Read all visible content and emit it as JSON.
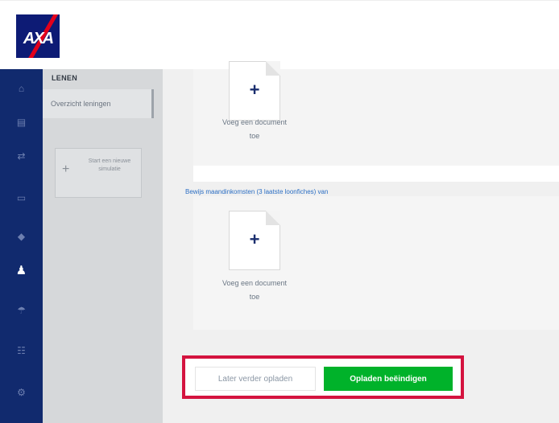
{
  "brand": {
    "logo_text": "AXA",
    "logo_bg": "#0d1b75",
    "logo_slash": "#e3001b"
  },
  "nav": {
    "icons": [
      {
        "name": "home-icon",
        "glyph": "⌂"
      },
      {
        "name": "accounts-icon",
        "glyph": "▤"
      },
      {
        "name": "transfer-icon",
        "glyph": "⇄"
      },
      {
        "name": "card-icon",
        "glyph": "▭"
      },
      {
        "name": "savings-icon",
        "glyph": "◆"
      },
      {
        "name": "loans-icon",
        "glyph": "♟"
      },
      {
        "name": "insurance-icon",
        "glyph": "☂"
      },
      {
        "name": "profile-icon",
        "glyph": "☷"
      },
      {
        "name": "settings-icon",
        "glyph": "⚙"
      }
    ],
    "active_index": 5
  },
  "loans_panel": {
    "header": "LENEN",
    "item_overview": "Overzicht leningen",
    "new_simulation": "Start een nieuwe simulatie"
  },
  "documents": {
    "tile1_caption_line1": "Voeg een document",
    "tile1_caption_line2": "toe",
    "section2_label": "Bewijs maandinkomsten (3 laatste loonfiches) van",
    "tile2_caption_line1": "Voeg een document",
    "tile2_caption_line2": "toe",
    "add_symbol": "+"
  },
  "actions": {
    "later_label": "Later verder opladen",
    "finish_label": "Opladen beëindigen",
    "finish_color": "#00b22a",
    "highlight_color": "#d4133f"
  }
}
